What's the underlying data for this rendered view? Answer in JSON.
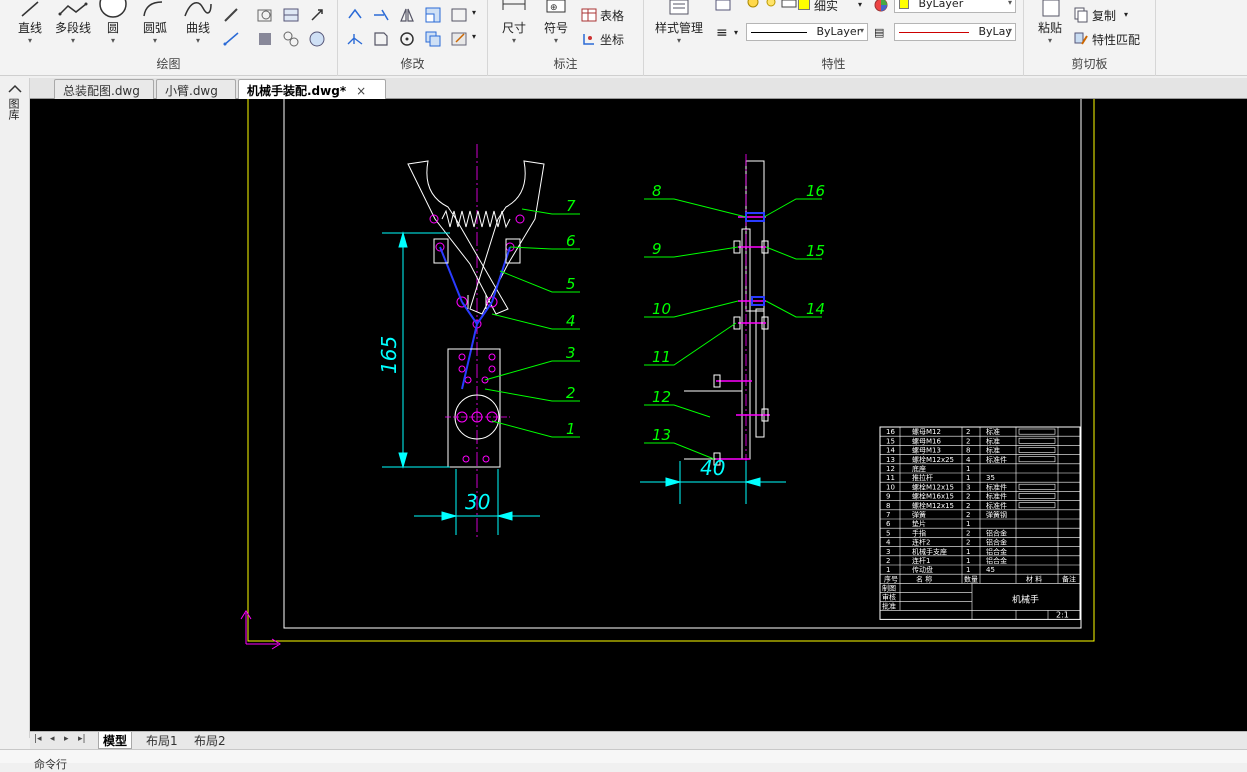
{
  "ribbon": {
    "draw": {
      "title": "绘图",
      "line": "直线",
      "polyline": "多段线",
      "circle": "圆",
      "arc": "圆弧",
      "curve": "曲线"
    },
    "modify": {
      "title": "修改"
    },
    "annotate": {
      "title": "标注",
      "dimension": "尺寸",
      "symbol": "符号",
      "table": "表格",
      "coordinate": "坐标"
    },
    "properties": {
      "title": "特性",
      "style_manager": "样式管理",
      "layer_name": "细实",
      "color_value": "ByLayer",
      "linetype_value": "ByLayer",
      "lineweight_value": "ByLay"
    },
    "clipboard": {
      "title": "剪切板",
      "paste": "粘贴",
      "copy": "复制",
      "match_props": "特性匹配"
    }
  },
  "tabs": [
    {
      "label": "总装配图.dwg",
      "active": false
    },
    {
      "label": "小臂.dwg",
      "active": false
    },
    {
      "label": "机械手装配.dwg*",
      "active": true
    }
  ],
  "left_panel_label": "图库",
  "layout_tabs": [
    {
      "label": "模型",
      "active": true
    },
    {
      "label": "布局1",
      "active": false
    },
    {
      "label": "布局2",
      "active": false
    }
  ],
  "command_line": "命令行",
  "drawing": {
    "dims": {
      "height": "165",
      "width_front": "30",
      "width_side": "40"
    },
    "front_balloons": [
      "7",
      "6",
      "5",
      "4",
      "3",
      "2",
      "1"
    ],
    "side_balloons_left": [
      "8",
      "9",
      "10",
      "11",
      "12",
      "13"
    ],
    "side_balloons_right": [
      "16",
      "15",
      "14"
    ],
    "bom": {
      "rows": [
        {
          "no": "16",
          "name": "螺母M12",
          "qty": "2",
          "mat": "标准"
        },
        {
          "no": "15",
          "name": "螺母M16",
          "qty": "2",
          "mat": "标准"
        },
        {
          "no": "14",
          "name": "螺母M13",
          "qty": "8",
          "mat": "标准"
        },
        {
          "no": "13",
          "name": "螺栓M12x25",
          "qty": "4",
          "mat": "标准件"
        },
        {
          "no": "12",
          "name": "底座",
          "qty": "1",
          "mat": ""
        },
        {
          "no": "11",
          "name": "推拉杆",
          "qty": "1",
          "mat": "35"
        },
        {
          "no": "10",
          "name": "螺栓M12x15",
          "qty": "3",
          "mat": "标准件"
        },
        {
          "no": "9",
          "name": "螺栓M16x15",
          "qty": "2",
          "mat": "标准件"
        },
        {
          "no": "8",
          "name": "螺栓M12x15",
          "qty": "2",
          "mat": "标准件"
        },
        {
          "no": "7",
          "name": "弹簧",
          "qty": "2",
          "mat": "弹簧钢"
        },
        {
          "no": "6",
          "name": "垫片",
          "qty": "1",
          "mat": ""
        },
        {
          "no": "5",
          "name": "手指",
          "qty": "2",
          "mat": "铝合金"
        },
        {
          "no": "4",
          "name": "连杆2",
          "qty": "2",
          "mat": "铝合金"
        },
        {
          "no": "3",
          "name": "机械手支座",
          "qty": "1",
          "mat": "铝合金"
        },
        {
          "no": "2",
          "name": "连杆1",
          "qty": "1",
          "mat": "铝合金"
        },
        {
          "no": "1",
          "name": "传动盘",
          "qty": "1",
          "mat": "45"
        }
      ],
      "header": {
        "no": "序号",
        "name": "名 称",
        "qty": "数量",
        "mat": "材 料",
        "note": "备注"
      },
      "title_rows": [
        "制图",
        "审核",
        "批准"
      ],
      "drawing_title": "机械手",
      "scale": "2:1"
    }
  }
}
